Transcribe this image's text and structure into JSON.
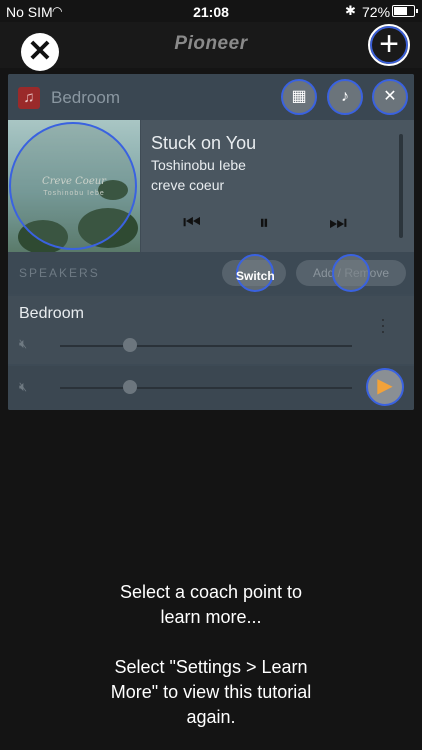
{
  "status_bar": {
    "carrier": "No SIM",
    "time": "21:08",
    "battery": "72%",
    "battery_level": 0.72
  },
  "top_bar": {
    "brand": "Pioneer"
  },
  "panel": {
    "room_name": "Bedroom",
    "now_playing": {
      "title": "Stuck on You",
      "artist": "Toshinobu Iebe",
      "album": "creve coeur",
      "art_title": "Creve Coeur",
      "art_subtitle": "Toshinobu Iebe"
    },
    "speakers": {
      "section_label": "SPEAKERS",
      "switch_label": "Switch",
      "add_remove_label": "Add / Remove",
      "items": [
        {
          "name": "Bedroom",
          "volume": 0.24
        }
      ]
    },
    "master_volume": 0.24
  },
  "coach": {
    "line1": "Select a coach point to",
    "line2": "learn more...",
    "line3": "Select \"Settings > Learn",
    "line4": "More\" to view this tutorial",
    "line5": "again."
  }
}
